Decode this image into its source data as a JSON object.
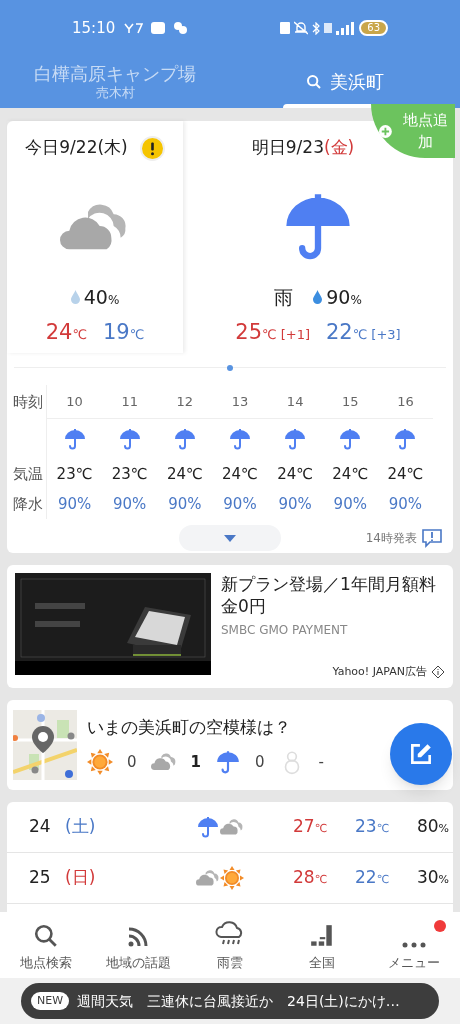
{
  "status_bar": {
    "time": "15:10",
    "battery": "63"
  },
  "tabs": [
    {
      "title": "白樺高原キャンプ場",
      "subtitle": "売木村",
      "selected": false,
      "search": false
    },
    {
      "title": "美浜町",
      "selected": true,
      "search": true
    }
  ],
  "add_location": "地点追加",
  "forecast": [
    {
      "date": "今日9/22",
      "weekday": "(木)",
      "holiday": false,
      "warning": true,
      "kind": "cloudy",
      "pop": "40",
      "pop_unit": "%",
      "high": "24",
      "low": "19",
      "unit": "℃"
    },
    {
      "date": "明日9/23",
      "weekday": "(金)",
      "holiday": true,
      "warning": false,
      "kind": "rain",
      "condition": "雨",
      "pop": "90",
      "pop_unit": "%",
      "high": "25",
      "high_diff": "[+1]",
      "low": "22",
      "low_diff": "[+3]",
      "unit": "℃"
    }
  ],
  "hourly": {
    "labels": [
      "時刻",
      "気温",
      "降水"
    ],
    "hours": [
      {
        "hour": "10",
        "kind": "rain",
        "temp": "23℃",
        "pop": "90%"
      },
      {
        "hour": "11",
        "kind": "rain",
        "temp": "23℃",
        "pop": "90%"
      },
      {
        "hour": "12",
        "kind": "rain",
        "temp": "24℃",
        "pop": "90%"
      },
      {
        "hour": "13",
        "kind": "rain",
        "temp": "24℃",
        "pop": "90%"
      },
      {
        "hour": "14",
        "kind": "rain",
        "temp": "24℃",
        "pop": "90%"
      },
      {
        "hour": "15",
        "kind": "rain",
        "temp": "24℃",
        "pop": "90%"
      },
      {
        "hour": "16",
        "kind": "rain",
        "temp": "24℃",
        "pop": "90%"
      }
    ],
    "issued": "14時発表"
  },
  "ad": {
    "kind": "picture",
    "headline": "新プラン登場／1年間月額料金0円",
    "sponsor": "SMBC GMO PAYMENT",
    "label": "Yahoo! JAPAN広告"
  },
  "sky_report": {
    "title": "いまの美浜町の空模様は？",
    "counts": [
      {
        "kind": "sunny",
        "count": "0"
      },
      {
        "kind": "cloudy",
        "count": "1"
      },
      {
        "kind": "rain",
        "count": "0"
      },
      {
        "kind": "snow",
        "count": "-"
      }
    ]
  },
  "weekly": [
    {
      "day": "24",
      "weekday": "(土)",
      "kind": "saturday",
      "icons": [
        {
          "kind": "rain"
        },
        {
          "kind": "cloudy"
        }
      ],
      "high": "27",
      "low": "23",
      "unit": "℃",
      "pop": "80",
      "pop_unit": "%"
    },
    {
      "day": "25",
      "weekday": "(日)",
      "kind": "sunday",
      "icons": [
        {
          "kind": "cloudy"
        },
        {
          "kind": "sunny"
        }
      ],
      "high": "28",
      "low": "22",
      "unit": "℃",
      "pop": "30",
      "pop_unit": "%"
    }
  ],
  "bottom_nav": [
    {
      "kind": "search",
      "label": "地点検索",
      "badge": false
    },
    {
      "kind": "feed",
      "label": "地域の話題",
      "badge": false
    },
    {
      "kind": "rain-cloud",
      "label": "雨雲",
      "badge": false
    },
    {
      "kind": "bars",
      "label": "全国",
      "badge": false
    },
    {
      "kind": "dots",
      "label": "メニュー",
      "badge": true
    }
  ],
  "ticker": {
    "badge": "NEW",
    "category": "週間天気",
    "headline": "三連休に台風接近か",
    "text": "24日(土)にかけ…"
  }
}
